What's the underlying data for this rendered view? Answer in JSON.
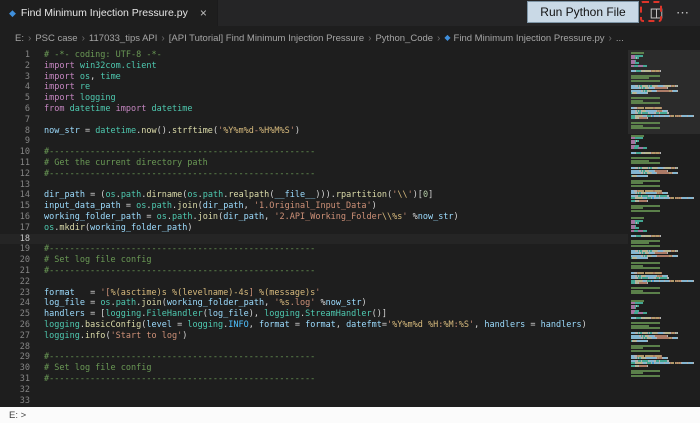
{
  "tab": {
    "title": "Find Minimum Injection Pressure.py",
    "close_label": "×",
    "file_icon": "◆"
  },
  "callout": {
    "label": "Run Python File"
  },
  "editor_actions": {
    "ellipsis": "⋯"
  },
  "breadcrumb": {
    "separator": "›",
    "items": [
      {
        "label": "E:"
      },
      {
        "label": "PSC case"
      },
      {
        "label": "117033_tips API"
      },
      {
        "label": "[API Tutorial] Find Minimum Injection Pressure"
      },
      {
        "label": "Python_Code"
      },
      {
        "label": "Find Minimum Injection Pressure.py",
        "icon": "◆"
      },
      {
        "label": "..."
      }
    ]
  },
  "colors": {
    "c": "#6A9955",
    "k": "#C586C0",
    "m": "#4EC9B0",
    "f": "#DCDCAA",
    "v": "#9CDCFE",
    "s": "#CE9178",
    "e": "#D7BA7D",
    "n": "#B5CEA8",
    "p": "#D4D4D4",
    "C": "#4FC1FF"
  },
  "minimap": {
    "repeats": 4
  },
  "bottom": {
    "text": "E: >"
  },
  "editor": {
    "lines": [
      {
        "n": 1,
        "t": [
          [
            "c",
            "# -*- coding: UTF-8 -*-"
          ]
        ]
      },
      {
        "n": 2,
        "t": [
          [
            "k",
            "import "
          ],
          [
            "m",
            "win32com.client"
          ]
        ]
      },
      {
        "n": 3,
        "t": [
          [
            "k",
            "import "
          ],
          [
            "m",
            "os"
          ],
          [
            "p",
            ", "
          ],
          [
            "m",
            "time"
          ]
        ]
      },
      {
        "n": 4,
        "t": [
          [
            "k",
            "import "
          ],
          [
            "m",
            "re"
          ]
        ]
      },
      {
        "n": 5,
        "t": [
          [
            "k",
            "import "
          ],
          [
            "m",
            "logging"
          ]
        ]
      },
      {
        "n": 6,
        "t": [
          [
            "k",
            "from "
          ],
          [
            "m",
            "datetime"
          ],
          [
            "k",
            " import "
          ],
          [
            "m",
            "datetime"
          ]
        ]
      },
      {
        "n": 7,
        "t": []
      },
      {
        "n": 8,
        "t": [
          [
            "v",
            "now_str"
          ],
          [
            "p",
            " = "
          ],
          [
            "m",
            "datetime"
          ],
          [
            "p",
            "."
          ],
          [
            "f",
            "now"
          ],
          [
            "p",
            "()."
          ],
          [
            "f",
            "strftime"
          ],
          [
            "p",
            "("
          ],
          [
            "s",
            "'"
          ],
          [
            "e",
            "%Y%m%d"
          ],
          [
            "s",
            "-"
          ],
          [
            "e",
            "%H%M%S"
          ],
          [
            "s",
            "'"
          ],
          [
            "p",
            ")"
          ]
        ]
      },
      {
        "n": 9,
        "t": []
      },
      {
        "n": 10,
        "t": [
          [
            "c",
            "#----------------------------------------------------"
          ]
        ]
      },
      {
        "n": 11,
        "t": [
          [
            "c",
            "# Get the current directory path"
          ]
        ]
      },
      {
        "n": 12,
        "t": [
          [
            "c",
            "#----------------------------------------------------"
          ]
        ]
      },
      {
        "n": 13,
        "t": []
      },
      {
        "n": 14,
        "t": [
          [
            "v",
            "dir_path"
          ],
          [
            "p",
            " = ("
          ],
          [
            "m",
            "os"
          ],
          [
            "p",
            "."
          ],
          [
            "m",
            "path"
          ],
          [
            "p",
            "."
          ],
          [
            "f",
            "dirname"
          ],
          [
            "p",
            "("
          ],
          [
            "m",
            "os"
          ],
          [
            "p",
            "."
          ],
          [
            "m",
            "path"
          ],
          [
            "p",
            "."
          ],
          [
            "f",
            "realpath"
          ],
          [
            "p",
            "("
          ],
          [
            "v",
            "__file__"
          ],
          [
            "p",
            ")))."
          ],
          [
            "f",
            "rpartition"
          ],
          [
            "p",
            "("
          ],
          [
            "s",
            "'"
          ],
          [
            "e",
            "\\\\"
          ],
          [
            "s",
            "'"
          ],
          [
            "p",
            ")["
          ],
          [
            "n",
            "0"
          ],
          [
            "p",
            "]"
          ]
        ]
      },
      {
        "n": 15,
        "t": [
          [
            "v",
            "input_data_path"
          ],
          [
            "p",
            " = "
          ],
          [
            "m",
            "os"
          ],
          [
            "p",
            "."
          ],
          [
            "m",
            "path"
          ],
          [
            "p",
            "."
          ],
          [
            "f",
            "join"
          ],
          [
            "p",
            "("
          ],
          [
            "v",
            "dir_path"
          ],
          [
            "p",
            ", "
          ],
          [
            "s",
            "'1.Original_Input_Data'"
          ],
          [
            "p",
            ")"
          ]
        ]
      },
      {
        "n": 16,
        "t": [
          [
            "v",
            "working_folder_path"
          ],
          [
            "p",
            " = "
          ],
          [
            "m",
            "os"
          ],
          [
            "p",
            "."
          ],
          [
            "m",
            "path"
          ],
          [
            "p",
            "."
          ],
          [
            "f",
            "join"
          ],
          [
            "p",
            "("
          ],
          [
            "v",
            "dir_path"
          ],
          [
            "p",
            ", "
          ],
          [
            "s",
            "'2.API_Working_Folder"
          ],
          [
            "e",
            "\\\\%s"
          ],
          [
            "s",
            "'"
          ],
          [
            "p",
            " %"
          ],
          [
            "v",
            "now_str"
          ],
          [
            "p",
            ")"
          ]
        ]
      },
      {
        "n": 17,
        "t": [
          [
            "m",
            "os"
          ],
          [
            "p",
            "."
          ],
          [
            "f",
            "mkdir"
          ],
          [
            "p",
            "("
          ],
          [
            "v",
            "working_folder_path"
          ],
          [
            "p",
            ")"
          ]
        ]
      },
      {
        "n": 18,
        "t": [],
        "active": true
      },
      {
        "n": 19,
        "t": [
          [
            "c",
            "#----------------------------------------------------"
          ]
        ]
      },
      {
        "n": 20,
        "t": [
          [
            "c",
            "# Set log file config"
          ]
        ]
      },
      {
        "n": 21,
        "t": [
          [
            "c",
            "#----------------------------------------------------"
          ]
        ]
      },
      {
        "n": 22,
        "t": []
      },
      {
        "n": 23,
        "t": [
          [
            "v",
            "format"
          ],
          [
            "p",
            "   = "
          ],
          [
            "s",
            "'["
          ],
          [
            "e",
            "%(asctime)s"
          ],
          [
            "s",
            " "
          ],
          [
            "e",
            "%(levelname)-4s"
          ],
          [
            "s",
            "] "
          ],
          [
            "e",
            "%(message)s"
          ],
          [
            "s",
            "'"
          ]
        ]
      },
      {
        "n": 24,
        "t": [
          [
            "v",
            "log_file"
          ],
          [
            "p",
            " = "
          ],
          [
            "m",
            "os"
          ],
          [
            "p",
            "."
          ],
          [
            "m",
            "path"
          ],
          [
            "p",
            "."
          ],
          [
            "f",
            "join"
          ],
          [
            "p",
            "("
          ],
          [
            "v",
            "working_folder_path"
          ],
          [
            "p",
            ", "
          ],
          [
            "s",
            "'"
          ],
          [
            "e",
            "%s"
          ],
          [
            "s",
            ".log'"
          ],
          [
            "p",
            " %"
          ],
          [
            "v",
            "now_str"
          ],
          [
            "p",
            ")"
          ]
        ]
      },
      {
        "n": 25,
        "t": [
          [
            "v",
            "handlers"
          ],
          [
            "p",
            " = ["
          ],
          [
            "m",
            "logging"
          ],
          [
            "p",
            "."
          ],
          [
            "m",
            "FileHandler"
          ],
          [
            "p",
            "("
          ],
          [
            "v",
            "log_file"
          ],
          [
            "p",
            "), "
          ],
          [
            "m",
            "logging"
          ],
          [
            "p",
            "."
          ],
          [
            "m",
            "StreamHandler"
          ],
          [
            "p",
            "()]"
          ]
        ]
      },
      {
        "n": 26,
        "t": [
          [
            "m",
            "logging"
          ],
          [
            "p",
            "."
          ],
          [
            "f",
            "basicConfig"
          ],
          [
            "p",
            "("
          ],
          [
            "v",
            "level"
          ],
          [
            "p",
            " = "
          ],
          [
            "m",
            "logging"
          ],
          [
            "p",
            "."
          ],
          [
            "C",
            "INFO"
          ],
          [
            "p",
            ", "
          ],
          [
            "v",
            "format"
          ],
          [
            "p",
            " = "
          ],
          [
            "v",
            "format"
          ],
          [
            "p",
            ", "
          ],
          [
            "v",
            "datefmt"
          ],
          [
            "p",
            "="
          ],
          [
            "s",
            "'"
          ],
          [
            "e",
            "%Y%m%d"
          ],
          [
            "s",
            " "
          ],
          [
            "e",
            "%H"
          ],
          [
            "s",
            ":"
          ],
          [
            "e",
            "%M"
          ],
          [
            "s",
            ":"
          ],
          [
            "e",
            "%S"
          ],
          [
            "s",
            "'"
          ],
          [
            "p",
            ", "
          ],
          [
            "v",
            "handlers"
          ],
          [
            "p",
            " = "
          ],
          [
            "v",
            "handlers"
          ],
          [
            "p",
            ")"
          ]
        ]
      },
      {
        "n": 27,
        "t": [
          [
            "m",
            "logging"
          ],
          [
            "p",
            "."
          ],
          [
            "f",
            "info"
          ],
          [
            "p",
            "("
          ],
          [
            "s",
            "'Start to log'"
          ],
          [
            "p",
            ")"
          ]
        ]
      },
      {
        "n": 28,
        "t": []
      },
      {
        "n": 29,
        "t": [
          [
            "c",
            "#----------------------------------------------------"
          ]
        ]
      },
      {
        "n": 30,
        "t": [
          [
            "c",
            "# Set log file config"
          ]
        ]
      },
      {
        "n": 31,
        "t": [
          [
            "c",
            "#----------------------------------------------------"
          ]
        ]
      },
      {
        "n": 32,
        "t": []
      },
      {
        "n": 33,
        "t": []
      }
    ]
  }
}
